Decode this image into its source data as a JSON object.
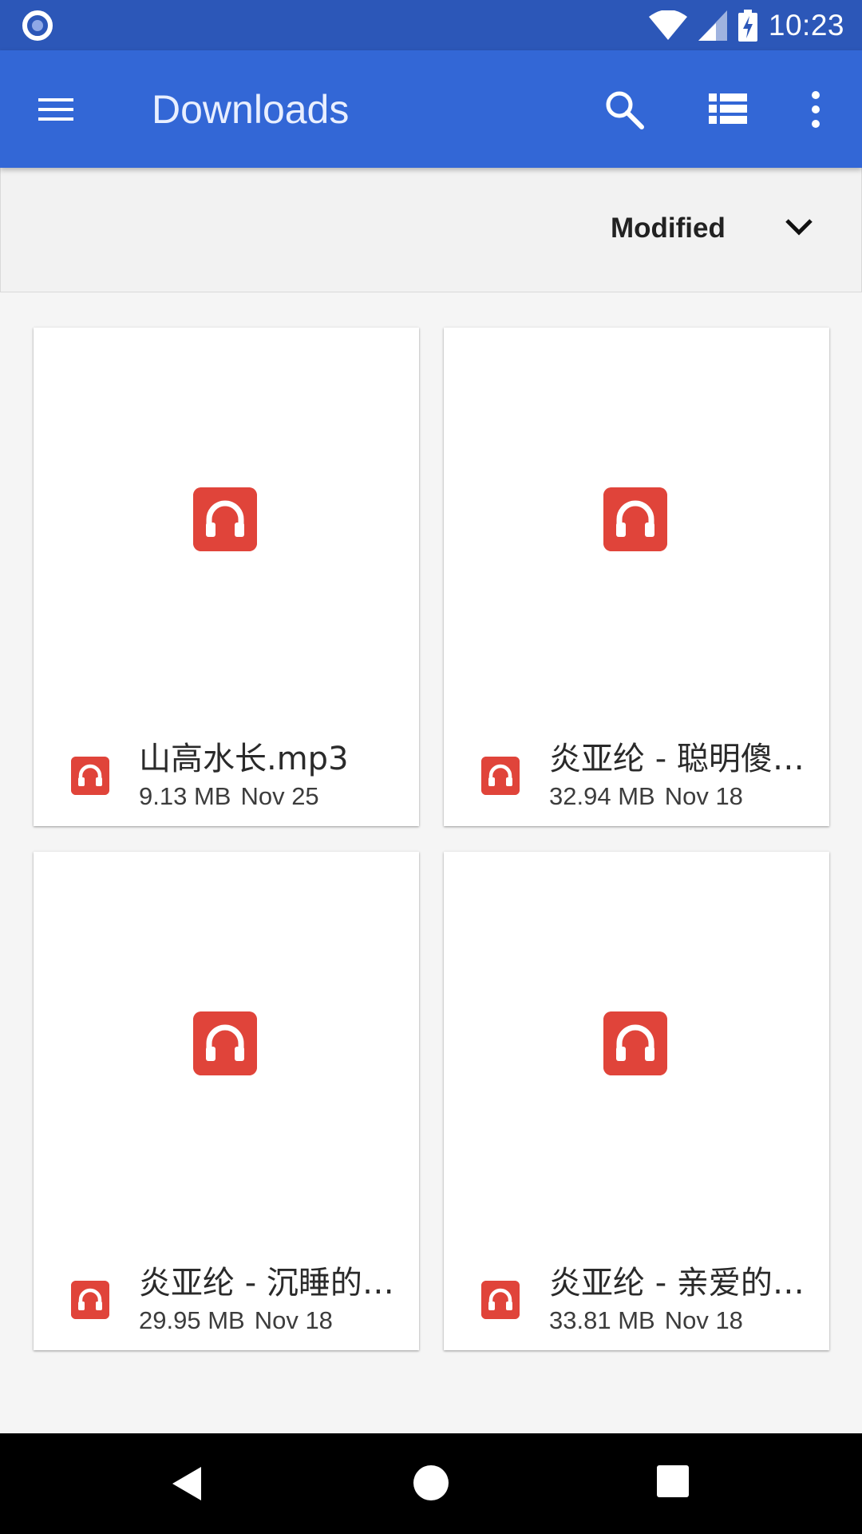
{
  "status_bar": {
    "time": "10:23",
    "icons": [
      "notification-dot-icon",
      "wifi-icon",
      "signal-icon",
      "battery-charging-icon"
    ]
  },
  "app_bar": {
    "title": "Downloads",
    "icons": [
      "menu-icon",
      "search-icon",
      "list-view-icon",
      "more-vert-icon"
    ]
  },
  "sort": {
    "label": "Modified",
    "icon": "chevron-down-icon"
  },
  "files": [
    {
      "name": "山高水长.mp3",
      "size": "9.13 MB",
      "date": "Nov 25",
      "icon": "headphones-icon"
    },
    {
      "name": "炎亚纶 - 聪明傻…",
      "size": "32.94 MB",
      "date": "Nov 18",
      "icon": "headphones-icon"
    },
    {
      "name": "炎亚纶 - 沉睡的…",
      "size": "29.95 MB",
      "date": "Nov 18",
      "icon": "headphones-icon"
    },
    {
      "name": "炎亚纶 - 亲爱的…",
      "size": "33.81 MB",
      "date": "Nov 18",
      "icon": "headphones-icon"
    }
  ],
  "colors": {
    "status_bar": "#2c57b8",
    "app_bar": "#3367d6",
    "audio_icon": "#e0443a"
  }
}
